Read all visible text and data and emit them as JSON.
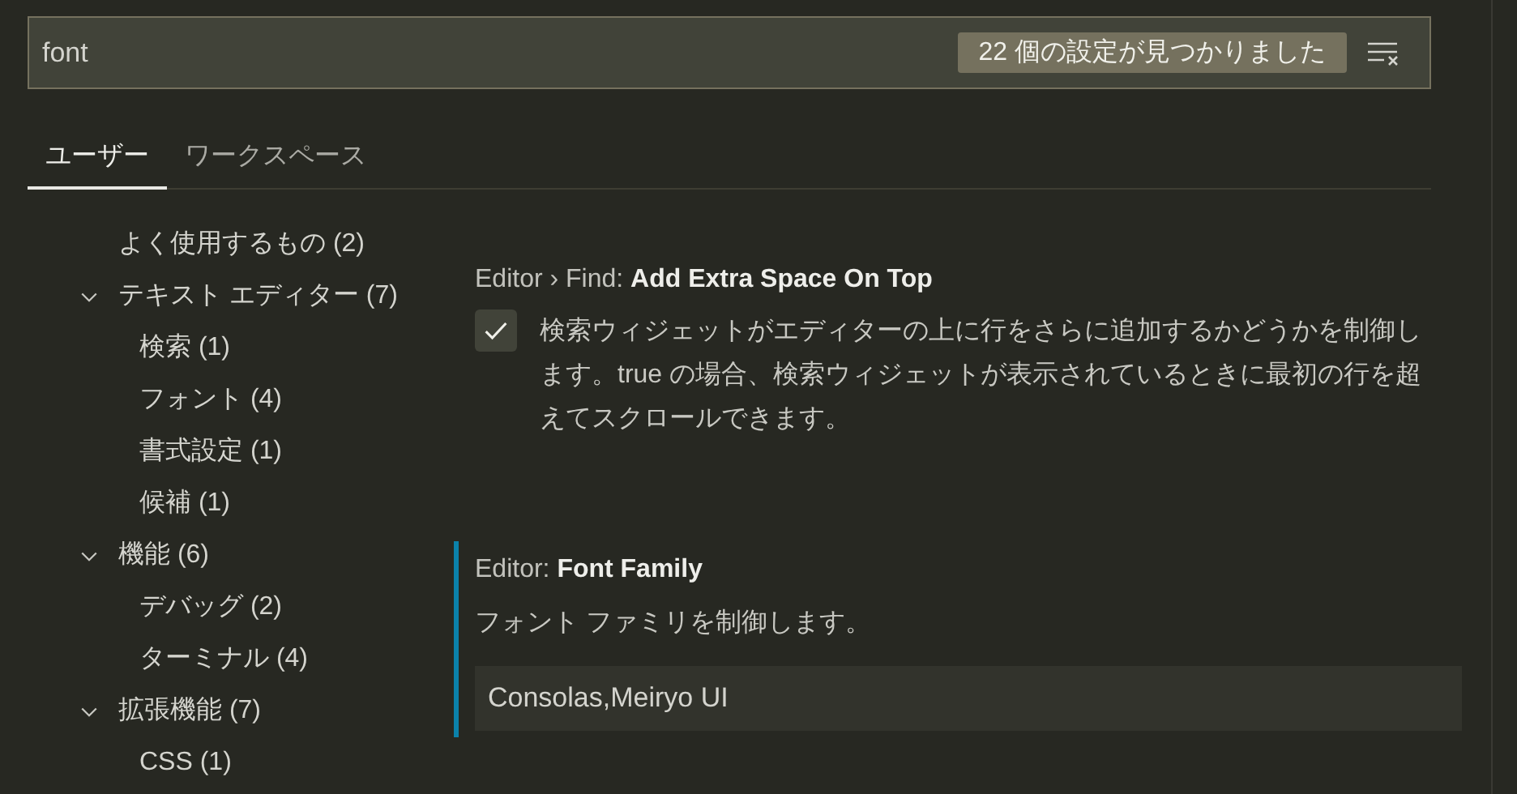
{
  "search": {
    "value": "font",
    "result_count": "22 個の設定が見つかりました"
  },
  "tabs": [
    {
      "label": "ユーザー",
      "selected": true
    },
    {
      "label": "ワークスペース",
      "selected": false
    }
  ],
  "toc": [
    {
      "label": "よく使用するもの (2)"
    },
    {
      "label": "テキスト エディター (7)",
      "expanded": true,
      "children": [
        {
          "label": "検索 (1)"
        },
        {
          "label": "フォント (4)"
        },
        {
          "label": "書式設定 (1)"
        },
        {
          "label": "候補 (1)"
        }
      ]
    },
    {
      "label": "機能 (6)",
      "expanded": true,
      "children": [
        {
          "label": "デバッグ (2)"
        },
        {
          "label": "ターミナル (4)"
        }
      ]
    },
    {
      "label": "拡張機能 (7)",
      "expanded": true,
      "children": [
        {
          "label": "CSS (1)"
        }
      ]
    }
  ],
  "settings": [
    {
      "kind": "checkbox",
      "category": "Editor › Find: ",
      "name": "Add Extra Space On Top",
      "focused": false,
      "checked": true,
      "description": "検索ウィジェットがエディターの上に行をさらに追加するかどうかを制御します。true の場合、検索ウィジェットが表示されているときに最初の行を超えてスクロールできます。"
    },
    {
      "kind": "text",
      "category": "Editor: ",
      "name": "Font Family",
      "focused": true,
      "description": "フォント ファミリを制御します。",
      "value": "Consolas,Meiryo UI"
    }
  ]
}
